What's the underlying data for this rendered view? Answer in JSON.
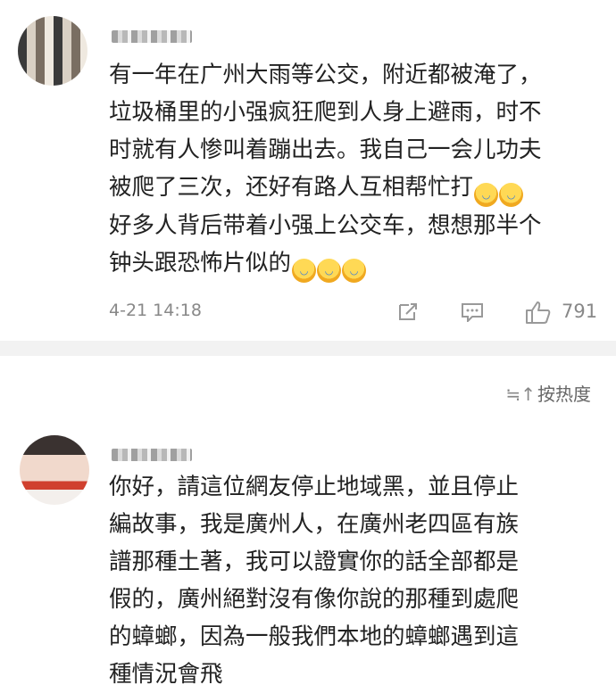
{
  "comments": [
    {
      "lines": [
        "有一年在广州大雨等公交，附近都被淹了，",
        "垃圾桶里的小强疯狂爬到人身上避雨，时不",
        "时就有人惨叫着蹦出去。我自己一会儿功夫",
        "被爬了三次，还好有路人互相帮忙打",
        "好多人背后带着小强上公交车，想想那半个",
        "钟头跟恐怖片似的"
      ],
      "timestamp": "4-21 14:18",
      "like_count": "791"
    },
    {
      "lines": [
        "你好，請這位網友停止地域黑，並且停止",
        "編故事，我是廣州人，在廣州老四區有族",
        "譜那種土著，我可以證實你的話全部都是",
        "假的，廣州絕對沒有像你說的那種到處爬",
        "的蟑螂，因為一般我們本地的蟑螂遇到這",
        "種情況會飛"
      ]
    }
  ],
  "sort": {
    "icon": "≒↑",
    "label": "按热度"
  },
  "icons": {
    "share": "share-icon",
    "comment": "comment-icon",
    "like": "thumbs-up-icon",
    "emoji": "laugh-cry-emoji"
  },
  "colors": {
    "text": "#222222",
    "meta": "#888888",
    "divider": "#f2f2f2"
  }
}
